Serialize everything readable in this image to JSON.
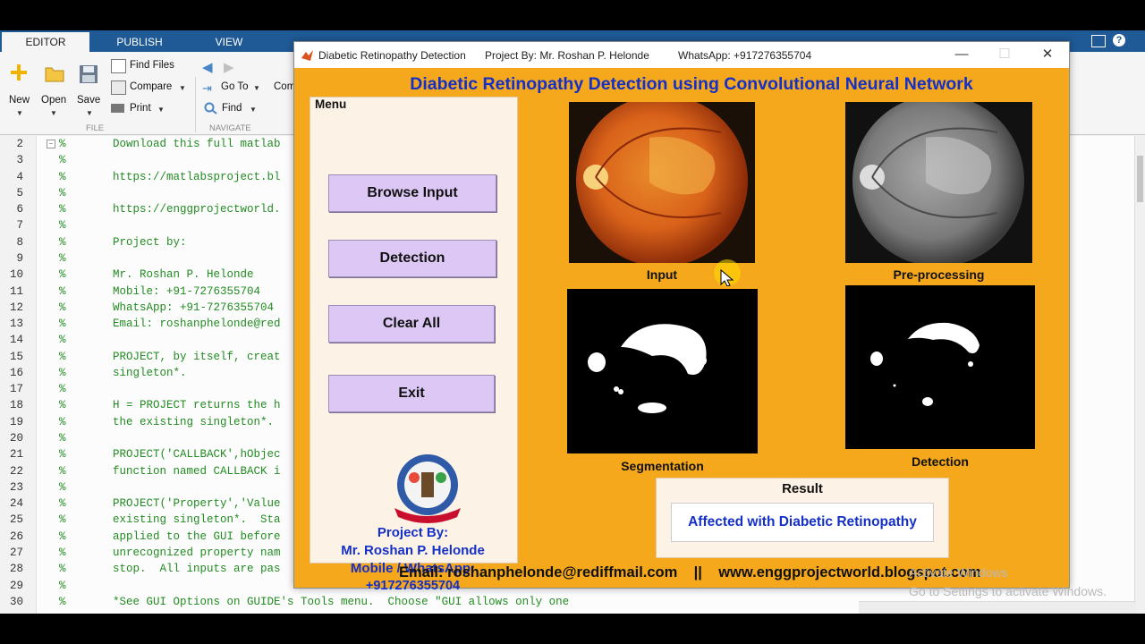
{
  "toolstrip": {
    "tabs": [
      "EDITOR",
      "PUBLISH",
      "VIEW"
    ],
    "file_group": {
      "new": "New",
      "open": "Open",
      "save": "Save",
      "label": "FILE"
    },
    "find_files": "Find Files",
    "compare": "Compare",
    "print": "Print",
    "navigate": {
      "goto": "Go To",
      "find": "Find",
      "label": "NAVIGATE",
      "truncated": "Com"
    }
  },
  "editor": {
    "lines": [
      {
        "n": "2",
        "text": "%       Download this full matlab"
      },
      {
        "n": "3",
        "text": "%"
      },
      {
        "n": "4",
        "text": "%       https://matlabsproject.bl"
      },
      {
        "n": "5",
        "text": "%"
      },
      {
        "n": "6",
        "text": "%       https://enggprojectworld."
      },
      {
        "n": "7",
        "text": "%"
      },
      {
        "n": "8",
        "text": "%       Project by:"
      },
      {
        "n": "9",
        "text": "%"
      },
      {
        "n": "10",
        "text": "%       Mr. Roshan P. Helonde"
      },
      {
        "n": "11",
        "text": "%       Mobile: +91-7276355704"
      },
      {
        "n": "12",
        "text": "%       WhatsApp: +91-7276355704"
      },
      {
        "n": "13",
        "text": "%       Email: roshanphelonde@red"
      },
      {
        "n": "14",
        "text": "%"
      },
      {
        "n": "15",
        "text": "%       PROJECT, by itself, creat"
      },
      {
        "n": "16",
        "text": "%       singleton*."
      },
      {
        "n": "17",
        "text": "%"
      },
      {
        "n": "18",
        "text": "%       H = PROJECT returns the h"
      },
      {
        "n": "19",
        "text": "%       the existing singleton*."
      },
      {
        "n": "20",
        "text": "%"
      },
      {
        "n": "21",
        "text": "%       PROJECT('CALLBACK',hObjec"
      },
      {
        "n": "22",
        "text": "%       function named CALLBACK i"
      },
      {
        "n": "23",
        "text": "%"
      },
      {
        "n": "24",
        "text": "%       PROJECT('Property','Value"
      },
      {
        "n": "25",
        "text": "%       existing singleton*.  Sta"
      },
      {
        "n": "26",
        "text": "%       applied to the GUI before"
      },
      {
        "n": "27",
        "text": "%       unrecognized property nam"
      },
      {
        "n": "28",
        "text": "%       stop.  All inputs are pas"
      },
      {
        "n": "29",
        "text": "%"
      },
      {
        "n": "30",
        "text": "%       *See GUI Options on GUIDE's Tools menu.  Choose \"GUI allows only one"
      }
    ]
  },
  "window": {
    "title": "Diabetic Retinopathy Detection",
    "project_by": "Project By: Mr. Roshan P. Helonde",
    "whatsapp": "WhatsApp: +917276355704",
    "controls": {
      "minimize": "—",
      "maximize": "☐",
      "close": "✕"
    }
  },
  "gui": {
    "heading": "Diabetic Retinopathy Detection using Convolutional Neural Network",
    "menu_label": "Menu",
    "buttons": {
      "browse": "Browse Input",
      "detection": "Detection",
      "clear": "Clear All",
      "exit": "Exit"
    },
    "credits": [
      "Project By:",
      "Mr. Roshan P. Helonde",
      "Mobile / WhatsApp:",
      "+917276355704"
    ],
    "captions": {
      "input": "Input",
      "preprocessing": "Pre-processing",
      "segmentation": "Segmentation",
      "detection": "Detection"
    },
    "result_label": "Result",
    "result_text": "Affected with Diabetic Retinopathy",
    "footer": "Email: roshanphelonde@rediffmail.com    ||    www.enggprojectworld.blogspot.com"
  },
  "watermark": {
    "line1": "Activate Windows",
    "line2": "Go to Settings to activate Windows."
  },
  "colors": {
    "gui_bg": "#f5a81c",
    "button": "#dcc7f5",
    "blue_text": "#1530c8",
    "matlab_tab": "#1f5a96"
  }
}
